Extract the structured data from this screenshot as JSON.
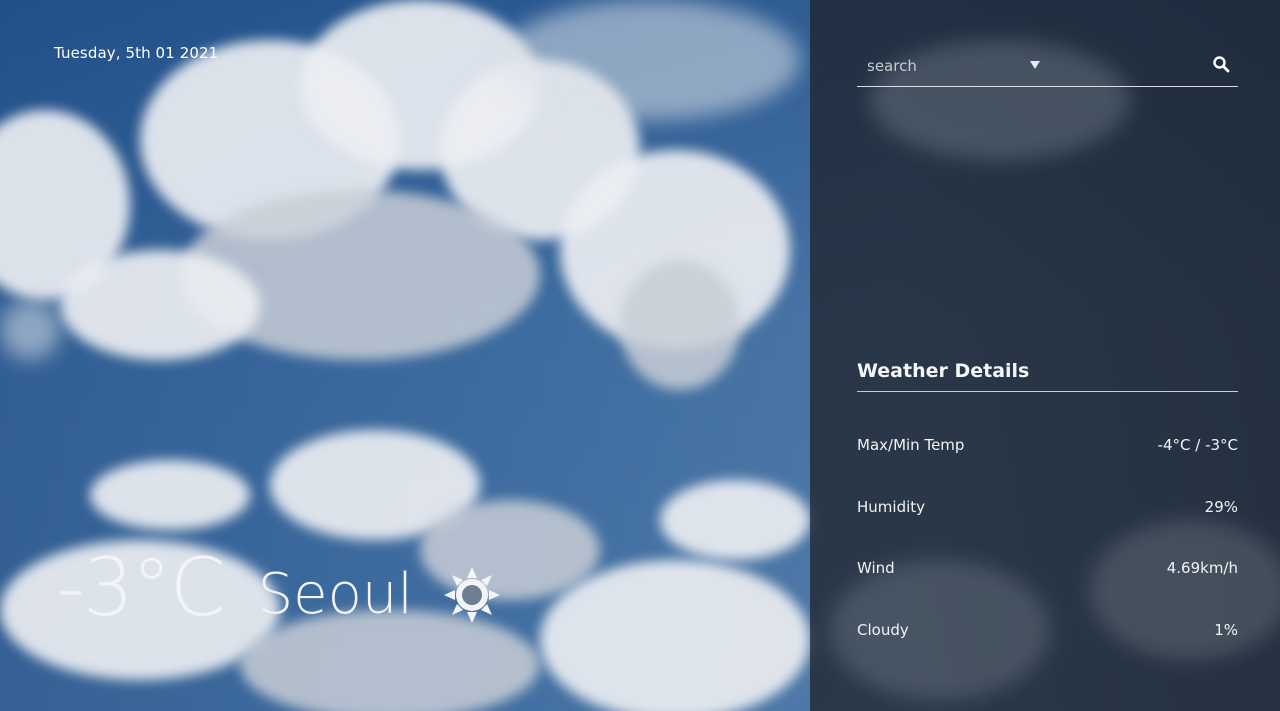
{
  "header": {
    "date": "Tuesday, 5th 01 2021"
  },
  "current": {
    "temperature": "-3°C",
    "city": "Seoul",
    "condition_icon": "sun-icon"
  },
  "search": {
    "placeholder": "search",
    "dropdown_icon": "caret-down-icon",
    "button_icon": "search-icon"
  },
  "details": {
    "title": "Weather Details",
    "rows": [
      {
        "label": "Max/Min Temp",
        "value": "-4°C / -3°C"
      },
      {
        "label": "Humidity",
        "value": "29%"
      },
      {
        "label": "Wind",
        "value": "4.69km/h"
      },
      {
        "label": "Cloudy",
        "value": "1%"
      }
    ]
  },
  "colors": {
    "panel_overlay": "#1c1e24",
    "text": "#ffffff",
    "sky": "#2f5e93"
  }
}
